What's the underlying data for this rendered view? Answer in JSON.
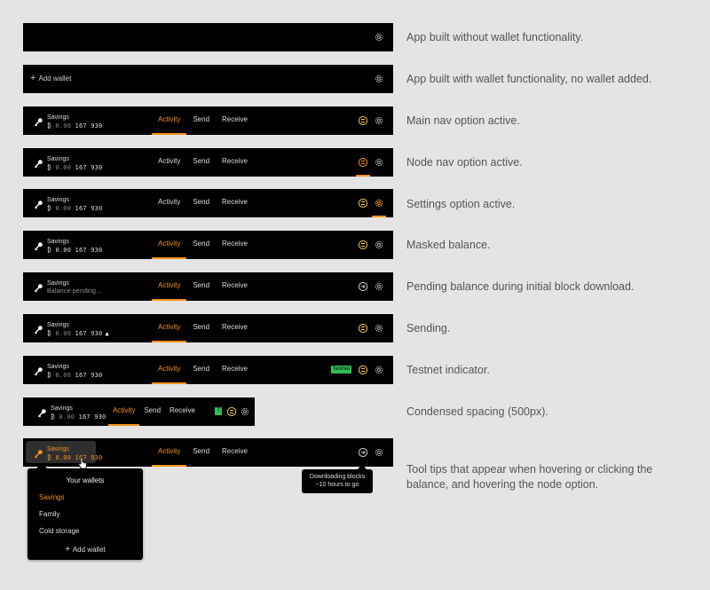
{
  "wallet": {
    "name": "Savings",
    "symbol": "₿",
    "balance_dim": "0.00",
    "balance_bright": " 167 930",
    "pending": "Balance pending…",
    "add_wallet": "Add wallet"
  },
  "nav": {
    "activity": "Activity",
    "send": "Send",
    "receive": "Receive"
  },
  "testnet": {
    "label": "Testnet",
    "short": "T"
  },
  "rows": [
    {
      "desc": "App built without wallet functionality."
    },
    {
      "desc": "App built with wallet functionality, no wallet added."
    },
    {
      "desc": "Main nav option active."
    },
    {
      "desc": "Node nav option active."
    },
    {
      "desc": "Settings option active."
    },
    {
      "desc": "Masked balance."
    },
    {
      "desc": "Pending balance during initial block download."
    },
    {
      "desc": "Sending."
    },
    {
      "desc": "Testnet indicator."
    },
    {
      "desc": "Condensed spacing (500px)."
    },
    {
      "desc": "Tool tips that appear when hovering or clicking the balance, and hovering the node option."
    }
  ],
  "dropdown": {
    "title": "Your wallets",
    "items": [
      "Savings",
      "Family",
      "Cold storage"
    ],
    "add": "Add wallet"
  },
  "tooltip": {
    "line1": "Downloading blocks",
    "line2": "~10 hours to go"
  },
  "colors": {
    "accent": "#f7931a",
    "testnet": "#2ebd59",
    "bar": "#000000",
    "background": "#e4e4e4"
  },
  "icons": [
    "gear-icon",
    "key-icon",
    "node-icon",
    "plus-icon",
    "sending-icon",
    "cursor-icon"
  ]
}
